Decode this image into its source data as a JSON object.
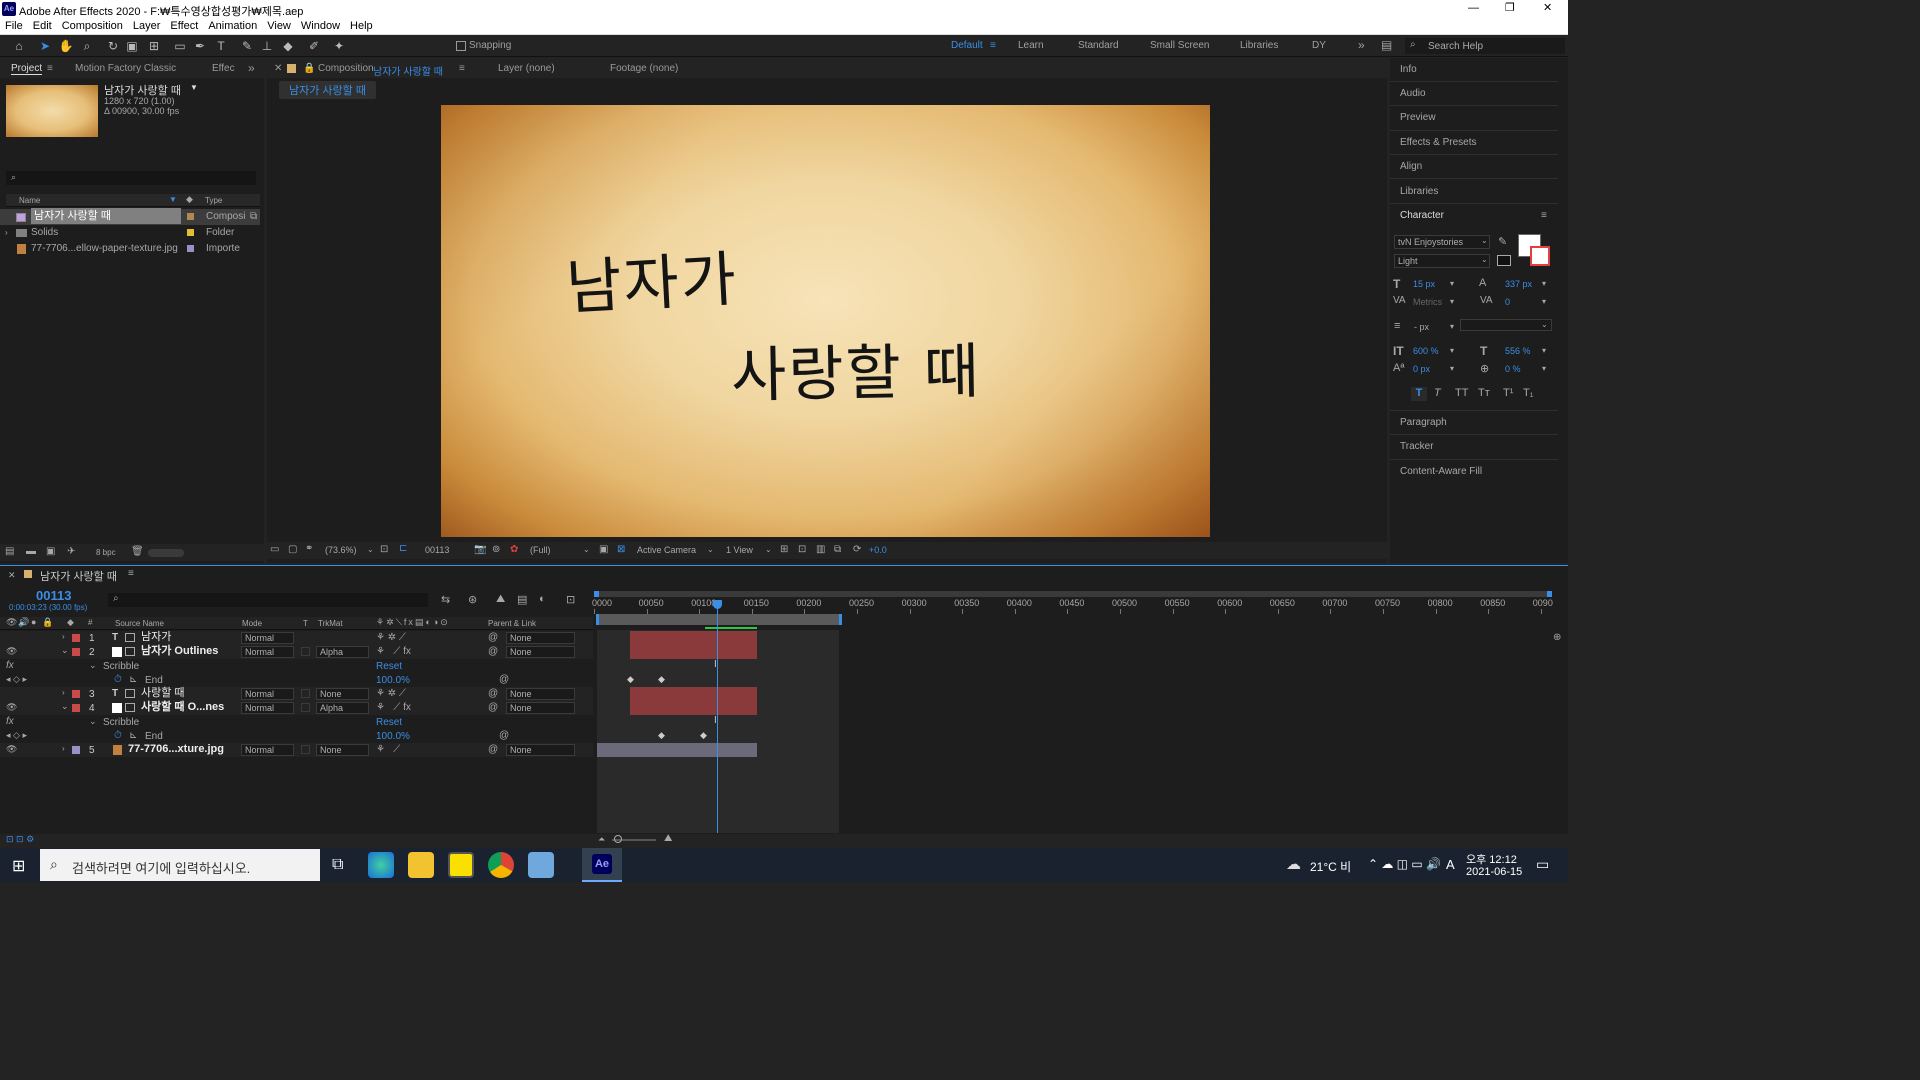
{
  "window": {
    "title": "Adobe After Effects 2020 - F:₩특수영상합성평가₩제목.aep",
    "app_badge": "Ae",
    "min": "—",
    "max": "❐",
    "close": "✕"
  },
  "menu": [
    "File",
    "Edit",
    "Composition",
    "Layer",
    "Effect",
    "Animation",
    "View",
    "Window",
    "Help"
  ],
  "toolbar": {
    "snapping": "Snapping",
    "workspaces": [
      "Default",
      "Learn",
      "Standard",
      "Small Screen",
      "Libraries",
      "DY"
    ],
    "more": "»",
    "search_placeholder": "Search Help"
  },
  "project": {
    "tabs": [
      "Project",
      "Motion Factory Classic",
      "Effec"
    ],
    "more": "»",
    "comp_name": "남자가 사랑할 때",
    "comp_size": "1280 x 720 (1.00)",
    "comp_duration": "Δ 00900, 30.00 fps",
    "col_name": "Name",
    "col_type": "Type",
    "items": [
      {
        "name": "남자가 사랑할 때",
        "type": "Composi",
        "color": "#b08850"
      },
      {
        "name": "Solids",
        "type": "Folder",
        "color": "#e0c030"
      },
      {
        "name": "77-7706...ellow-paper-texture.jpg",
        "type": "Importe",
        "color": "#9a90c8"
      }
    ],
    "bpc": "8 bpc"
  },
  "viewer": {
    "tab_comp": "Composition",
    "tab_comp_name": "남자가 사랑할 때",
    "tab_layer": "Layer (none)",
    "tab_footage": "Footage (none)",
    "breadcrumb": "남자가 사랑할 때",
    "line1": "남자가",
    "line2": "사랑할 때",
    "zoom": "(73.6%)",
    "time": "00113",
    "resolution": "(Full)",
    "camera": "Active Camera",
    "views": "1 View",
    "exposure": "+0.0"
  },
  "right_panel": {
    "sections_top": [
      "Info",
      "Audio",
      "Preview",
      "Effects & Presets",
      "Align",
      "Libraries"
    ],
    "character": "Character",
    "font": "tvN Enjoystories",
    "style": "Light",
    "font_size": "15 px",
    "leading": "337 px",
    "kerning": "Metrics",
    "tracking": "0",
    "stroke_unit": "- px",
    "vscale": "600 %",
    "hscale": "556 %",
    "baseline": "0 px",
    "tsume": "0 %",
    "styles": [
      "T",
      "T",
      "TT",
      "Tт",
      "T¹",
      "T₁"
    ],
    "sections_bottom": [
      "Paragraph",
      "Tracker",
      "Content-Aware Fill"
    ]
  },
  "timeline": {
    "comp_tab": "남자가 사랑할 때",
    "timecode": "00113",
    "timecode_sub": "0:00:03:23 (30.00 fps)",
    "headers": {
      "num": "#",
      "source": "Source Name",
      "mode": "Mode",
      "t": "T",
      "trkmat": "TrkMat",
      "parent": "Parent & Link"
    },
    "ruler": [
      "0000",
      "00050",
      "00100",
      "00150",
      "00200",
      "00250",
      "00300",
      "00350",
      "00400",
      "00450",
      "00500",
      "00550",
      "00600",
      "00650",
      "00700",
      "00750",
      "00800",
      "00850",
      "0090"
    ],
    "layers": [
      {
        "num": "1",
        "name": "남자가",
        "mode": "Normal",
        "trkmat": "",
        "parent": "None",
        "color": "#c84a4a",
        "type": "T"
      },
      {
        "num": "2",
        "name": "남자가 Outlines",
        "mode": "Normal",
        "trkmat": "Alpha",
        "parent": "None",
        "color": "#c84a4a",
        "type": "S"
      },
      {
        "num": "3",
        "name": "사랑할 때",
        "mode": "Normal",
        "trkmat": "None",
        "parent": "None",
        "color": "#c84a4a",
        "type": "T"
      },
      {
        "num": "4",
        "name": "사랑할 때 O...nes",
        "mode": "Normal",
        "trkmat": "Alpha",
        "parent": "None",
        "color": "#c84a4a",
        "type": "S"
      },
      {
        "num": "5",
        "name": "77-7706...xture.jpg",
        "mode": "Normal",
        "trkmat": "None",
        "parent": "None",
        "color": "#9a90c8",
        "type": "I"
      }
    ],
    "effect_name": "Scribble",
    "reset": "Reset",
    "prop_name": "End",
    "prop_value": "100.0%"
  },
  "taskbar": {
    "search": "검색하려면 여기에 입력하십시오.",
    "weather": "21°C 비",
    "ime": "A",
    "time": "오후 12:12",
    "date": "2021-06-15"
  }
}
